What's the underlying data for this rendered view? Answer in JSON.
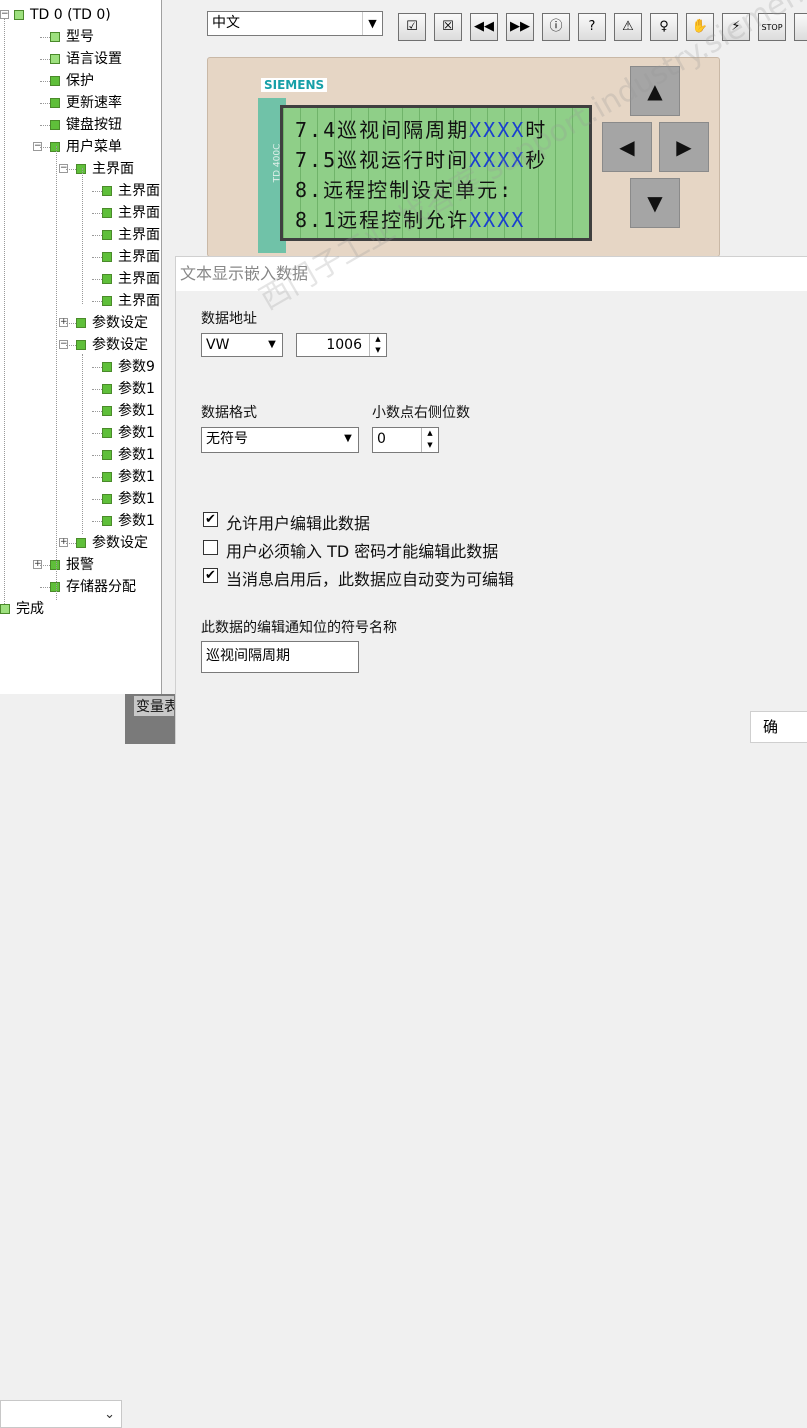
{
  "tree": {
    "root": "TD 0 (TD 0)",
    "items": [
      {
        "label": "型号",
        "light": true
      },
      {
        "label": "语言设置",
        "light": true
      },
      {
        "label": "保护"
      },
      {
        "label": "更新速率"
      },
      {
        "label": "键盘按钮"
      },
      {
        "label": "用户菜单"
      },
      {
        "label": "主界面"
      },
      {
        "label": "主界面"
      },
      {
        "label": "主界面"
      },
      {
        "label": "主界面"
      },
      {
        "label": "主界面"
      },
      {
        "label": "主界面"
      },
      {
        "label": "主界面"
      },
      {
        "label": "参数设定"
      },
      {
        "label": "参数设定"
      },
      {
        "label": "参数9"
      },
      {
        "label": "参数1"
      },
      {
        "label": "参数1"
      },
      {
        "label": "参数1"
      },
      {
        "label": "参数1"
      },
      {
        "label": "参数1"
      },
      {
        "label": "参数1"
      },
      {
        "label": "参数1"
      },
      {
        "label": "参数设定"
      },
      {
        "label": "报警"
      },
      {
        "label": "存储器分配"
      },
      {
        "label": "完成",
        "light": true
      }
    ]
  },
  "bottom_tab": {
    "label": "变量表"
  },
  "toolbar": {
    "language": "中文",
    "icons": [
      "check-box-icon",
      "cross-box-icon",
      "rewind-icon",
      "fast-forward-icon",
      "info-icon",
      "help-icon",
      "warning-icon",
      "bulb-icon",
      "hand-icon",
      "lightning-icon",
      "stop-icon"
    ],
    "glyphs": [
      "☑",
      "☒",
      "◀◀",
      "▶▶",
      "ⓘ",
      "?",
      "⚠",
      "♀",
      "✋",
      "⚡",
      "STOP"
    ]
  },
  "td400": {
    "brand": "SIEMENS",
    "model": "TD 400C",
    "lines": [
      {
        "text": "7.4巡视间隔周期",
        "var": "XXXX",
        "tail": "时"
      },
      {
        "text": "7.5巡视运行时间",
        "var": "XXXX",
        "tail": "秒"
      },
      {
        "text": "8.远程控制设定单元:",
        "var": "",
        "tail": ""
      },
      {
        "text": "8.1远程控制允许",
        "var": "XXXX",
        "tail": ""
      }
    ]
  },
  "dialog": {
    "title": "文本显示嵌入数据",
    "address_label": "数据地址",
    "address_type": "VW",
    "address_value": "1006",
    "format_label": "数据格式",
    "format_value": "无符号",
    "decimals_label": "小数点右侧位数",
    "decimals_value": "0",
    "checkboxes": [
      {
        "label": "允许用户编辑此数据",
        "checked": true
      },
      {
        "label": "用户必须输入 TD 密码才能编辑此数据",
        "checked": false
      },
      {
        "label": "当消息启用后，此数据应自动变为可编辑",
        "checked": true
      }
    ],
    "symbol_label": "此数据的编辑通知位的符号名称",
    "symbol_value": "巡视间隔周期",
    "ok_label": "确"
  },
  "watermark": "西门子工业 找答案 support.industry.siemens.com/cs"
}
